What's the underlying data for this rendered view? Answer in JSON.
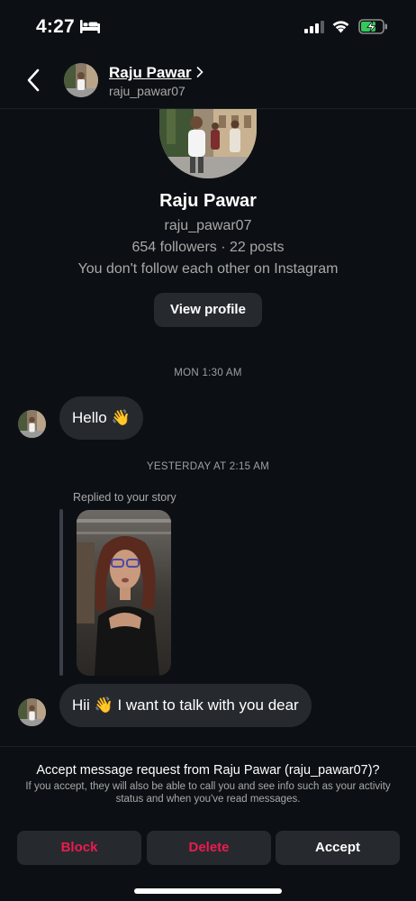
{
  "status_bar": {
    "time": "4:27",
    "icons": [
      "bed-icon",
      "signal-icon",
      "wifi-icon",
      "battery-charging-icon"
    ]
  },
  "header": {
    "name": "Raju Pawar",
    "username": "raju_pawar07"
  },
  "profile": {
    "name": "Raju Pawar",
    "username": "raju_pawar07",
    "stats": "654 followers · 22 posts",
    "follow_status": "You don't follow each other on Instagram",
    "view_profile_label": "View profile"
  },
  "messages": [
    {
      "timestamp": "MON 1:30 AM",
      "text": "Hello 👋"
    },
    {
      "timestamp": "YESTERDAY AT 2:15 AM",
      "replied_label": "Replied to your story",
      "text": "Hii 👋 I want to talk with you dear"
    }
  ],
  "request": {
    "title": "Accept message request from Raju Pawar (raju_pawar07)?",
    "description": "If you accept, they will also be able to call you and see info such as your activity status and when you've read messages.",
    "block_label": "Block",
    "delete_label": "Delete",
    "accept_label": "Accept"
  },
  "colors": {
    "background": "#0c1014",
    "bubble": "#262a2f",
    "danger": "#ed1a4e",
    "secondary_text": "#a8a8a8"
  }
}
